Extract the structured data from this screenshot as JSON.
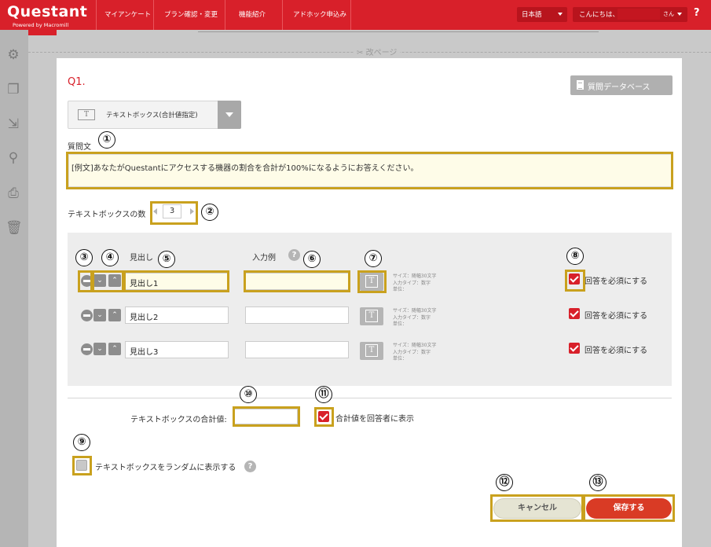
{
  "header": {
    "logo": "Questant",
    "logo_sub": "Powered by Macromill",
    "nav": [
      "マイアンケート",
      "プラン確認・変更",
      "機能紹介",
      "アドホック申込み"
    ],
    "language": "日本語",
    "greeting": "こんにちは、",
    "user_suffix": "さん",
    "help": "?"
  },
  "sidebar": {
    "icons": [
      "gear-icon",
      "copy-icon",
      "move-icon",
      "search-icon",
      "print-icon",
      "trash-icon"
    ]
  },
  "page_break": "改ページ",
  "question": {
    "number": "Q1.",
    "database_button": "質問データベース",
    "type_label": "テキストボックス(合計値指定)",
    "text_label": "質問文",
    "text_value": "[例文]あなたがQuestantにアクセスする機器の割合を合計が100%になるようにお答えください。",
    "count_label": "テキストボックスの数",
    "count_value": "3"
  },
  "table": {
    "heading_label": "見出し",
    "example_label": "入力例",
    "rows": [
      {
        "heading": "見出し1",
        "example": "",
        "info": [
          "サイズ：随幅30文字",
          "入力タイプ：数字",
          "単位："
        ],
        "required": "回答を必須にする"
      },
      {
        "heading": "見出し2",
        "example": "",
        "info": [
          "サイズ：随幅30文字",
          "入力タイプ：数字",
          "単位："
        ],
        "required": "回答を必須にする"
      },
      {
        "heading": "見出し3",
        "example": "",
        "info": [
          "サイズ：随幅30文字",
          "入力タイプ：数字",
          "単位："
        ],
        "required": "回答を必須にする"
      }
    ]
  },
  "total": {
    "label": "テキストボックスの合計値:",
    "value": "",
    "show_label": "合計値を回答者に表示"
  },
  "random_label": "テキストボックスをランダムに表示する",
  "buttons": {
    "cancel": "キャンセル",
    "save": "保存する"
  },
  "callouts": [
    "①",
    "②",
    "③",
    "④",
    "⑤",
    "⑥",
    "⑦",
    "⑧",
    "⑨",
    "⑩",
    "⑪",
    "⑫",
    "⑬"
  ],
  "colors": {
    "brand_red": "#d8202a",
    "highlight": "#c9a11e",
    "save_button": "#d93b25"
  }
}
